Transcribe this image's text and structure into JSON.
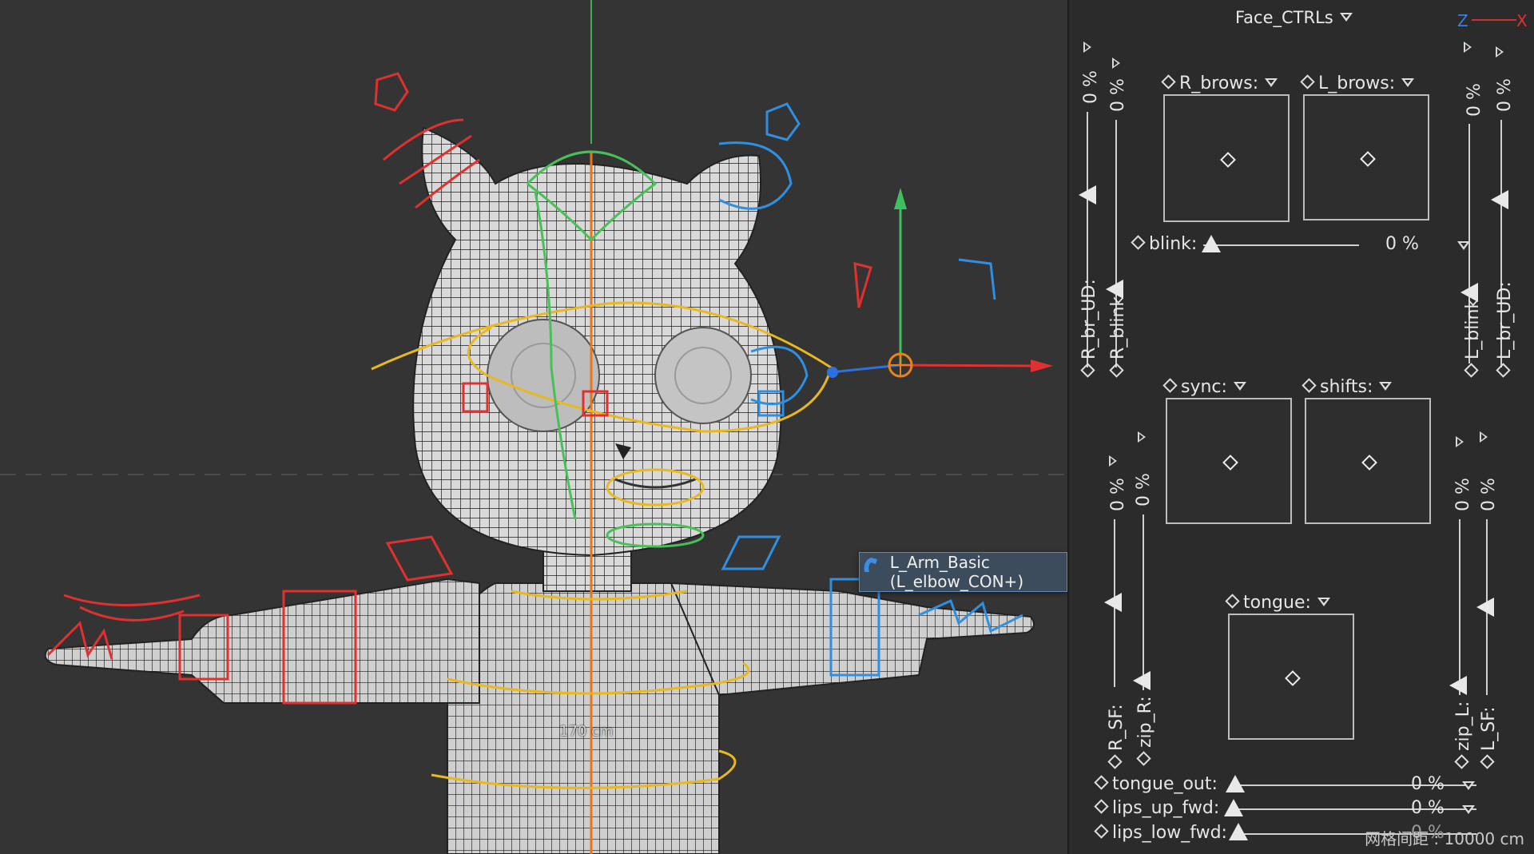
{
  "viewport": {
    "measure_label": "170 cm",
    "tooltip_label": "L_Arm_Basic (L_elbow_CON+)",
    "grid_readout": "网格间距 : 10000 cm",
    "axis_labels": {
      "z": "Z",
      "x": "X"
    }
  },
  "panel": {
    "title": "Face_CTRLs",
    "r_brows": "R_brows:",
    "l_brows": "L_brows:",
    "blink": "blink:",
    "blink_value": "0 %",
    "sync": "sync:",
    "shifts": "shifts:",
    "tongue": "tongue:",
    "sliders": [
      {
        "label": "tongue_out:",
        "value": "0 %"
      },
      {
        "label": "lips_up_fwd:",
        "value": "0 %"
      },
      {
        "label": "lips_low_fwd:",
        "value": "0 %"
      }
    ],
    "vertical": {
      "r_br_ud": "R_br_UD:",
      "r_blink": "R_blink:",
      "l_blink": "L_blink:",
      "l_br_ud": "L_br_UD:",
      "r_sf": "R_SF:",
      "zip_r": "zip_R:",
      "zip_l": "zip_L:",
      "l_sf": "L_SF:",
      "pct": "0 %"
    }
  },
  "colors": {
    "panel_bg": "#2b2b2b",
    "viewport_bg": "#343434",
    "tooltip_bg": "#3d4c5c",
    "right_side": "#e03030",
    "left_side": "#2f8fe0",
    "center": "#e8b020",
    "green": "#40c060"
  }
}
